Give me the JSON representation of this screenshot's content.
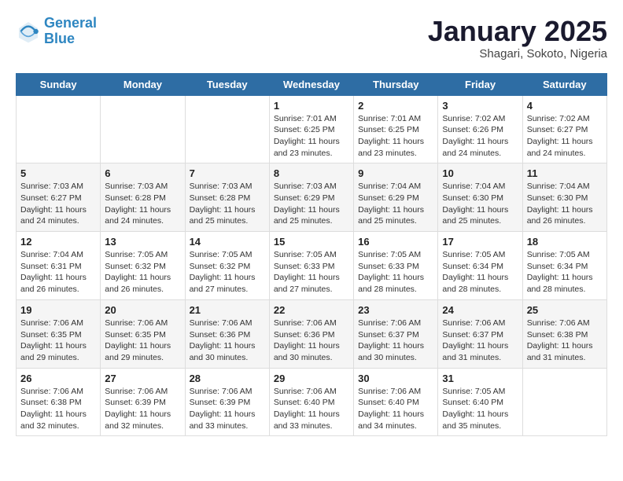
{
  "logo": {
    "line1": "General",
    "line2": "Blue"
  },
  "title": "January 2025",
  "subtitle": "Shagari, Sokoto, Nigeria",
  "weekdays": [
    "Sunday",
    "Monday",
    "Tuesday",
    "Wednesday",
    "Thursday",
    "Friday",
    "Saturday"
  ],
  "weeks": [
    [
      {
        "day": "",
        "info": ""
      },
      {
        "day": "",
        "info": ""
      },
      {
        "day": "",
        "info": ""
      },
      {
        "day": "1",
        "info": "Sunrise: 7:01 AM\nSunset: 6:25 PM\nDaylight: 11 hours and 23 minutes."
      },
      {
        "day": "2",
        "info": "Sunrise: 7:01 AM\nSunset: 6:25 PM\nDaylight: 11 hours and 23 minutes."
      },
      {
        "day": "3",
        "info": "Sunrise: 7:02 AM\nSunset: 6:26 PM\nDaylight: 11 hours and 24 minutes."
      },
      {
        "day": "4",
        "info": "Sunrise: 7:02 AM\nSunset: 6:27 PM\nDaylight: 11 hours and 24 minutes."
      }
    ],
    [
      {
        "day": "5",
        "info": "Sunrise: 7:03 AM\nSunset: 6:27 PM\nDaylight: 11 hours and 24 minutes."
      },
      {
        "day": "6",
        "info": "Sunrise: 7:03 AM\nSunset: 6:28 PM\nDaylight: 11 hours and 24 minutes."
      },
      {
        "day": "7",
        "info": "Sunrise: 7:03 AM\nSunset: 6:28 PM\nDaylight: 11 hours and 25 minutes."
      },
      {
        "day": "8",
        "info": "Sunrise: 7:03 AM\nSunset: 6:29 PM\nDaylight: 11 hours and 25 minutes."
      },
      {
        "day": "9",
        "info": "Sunrise: 7:04 AM\nSunset: 6:29 PM\nDaylight: 11 hours and 25 minutes."
      },
      {
        "day": "10",
        "info": "Sunrise: 7:04 AM\nSunset: 6:30 PM\nDaylight: 11 hours and 25 minutes."
      },
      {
        "day": "11",
        "info": "Sunrise: 7:04 AM\nSunset: 6:30 PM\nDaylight: 11 hours and 26 minutes."
      }
    ],
    [
      {
        "day": "12",
        "info": "Sunrise: 7:04 AM\nSunset: 6:31 PM\nDaylight: 11 hours and 26 minutes."
      },
      {
        "day": "13",
        "info": "Sunrise: 7:05 AM\nSunset: 6:32 PM\nDaylight: 11 hours and 26 minutes."
      },
      {
        "day": "14",
        "info": "Sunrise: 7:05 AM\nSunset: 6:32 PM\nDaylight: 11 hours and 27 minutes."
      },
      {
        "day": "15",
        "info": "Sunrise: 7:05 AM\nSunset: 6:33 PM\nDaylight: 11 hours and 27 minutes."
      },
      {
        "day": "16",
        "info": "Sunrise: 7:05 AM\nSunset: 6:33 PM\nDaylight: 11 hours and 28 minutes."
      },
      {
        "day": "17",
        "info": "Sunrise: 7:05 AM\nSunset: 6:34 PM\nDaylight: 11 hours and 28 minutes."
      },
      {
        "day": "18",
        "info": "Sunrise: 7:05 AM\nSunset: 6:34 PM\nDaylight: 11 hours and 28 minutes."
      }
    ],
    [
      {
        "day": "19",
        "info": "Sunrise: 7:06 AM\nSunset: 6:35 PM\nDaylight: 11 hours and 29 minutes."
      },
      {
        "day": "20",
        "info": "Sunrise: 7:06 AM\nSunset: 6:35 PM\nDaylight: 11 hours and 29 minutes."
      },
      {
        "day": "21",
        "info": "Sunrise: 7:06 AM\nSunset: 6:36 PM\nDaylight: 11 hours and 30 minutes."
      },
      {
        "day": "22",
        "info": "Sunrise: 7:06 AM\nSunset: 6:36 PM\nDaylight: 11 hours and 30 minutes."
      },
      {
        "day": "23",
        "info": "Sunrise: 7:06 AM\nSunset: 6:37 PM\nDaylight: 11 hours and 30 minutes."
      },
      {
        "day": "24",
        "info": "Sunrise: 7:06 AM\nSunset: 6:37 PM\nDaylight: 11 hours and 31 minutes."
      },
      {
        "day": "25",
        "info": "Sunrise: 7:06 AM\nSunset: 6:38 PM\nDaylight: 11 hours and 31 minutes."
      }
    ],
    [
      {
        "day": "26",
        "info": "Sunrise: 7:06 AM\nSunset: 6:38 PM\nDaylight: 11 hours and 32 minutes."
      },
      {
        "day": "27",
        "info": "Sunrise: 7:06 AM\nSunset: 6:39 PM\nDaylight: 11 hours and 32 minutes."
      },
      {
        "day": "28",
        "info": "Sunrise: 7:06 AM\nSunset: 6:39 PM\nDaylight: 11 hours and 33 minutes."
      },
      {
        "day": "29",
        "info": "Sunrise: 7:06 AM\nSunset: 6:40 PM\nDaylight: 11 hours and 33 minutes."
      },
      {
        "day": "30",
        "info": "Sunrise: 7:06 AM\nSunset: 6:40 PM\nDaylight: 11 hours and 34 minutes."
      },
      {
        "day": "31",
        "info": "Sunrise: 7:05 AM\nSunset: 6:40 PM\nDaylight: 11 hours and 35 minutes."
      },
      {
        "day": "",
        "info": ""
      }
    ]
  ]
}
